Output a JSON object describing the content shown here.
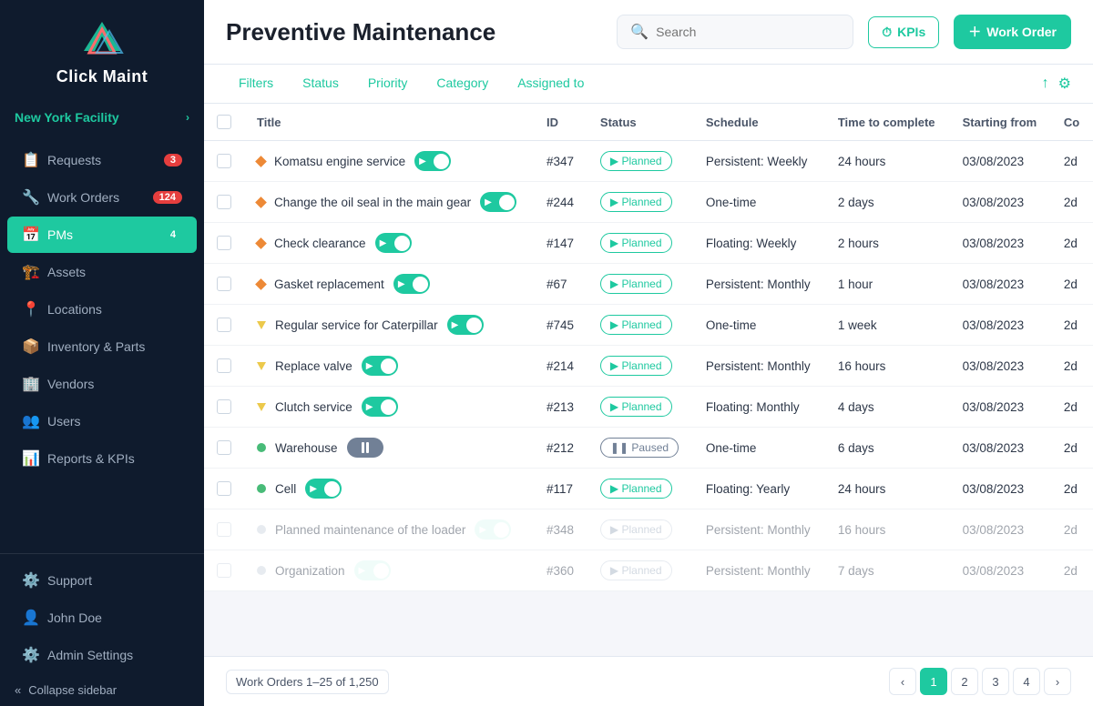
{
  "sidebar": {
    "logo_text": "Click Maint",
    "facility": "New York Facility",
    "nav_items": [
      {
        "id": "requests",
        "label": "Requests",
        "badge": "3",
        "badge_type": "red",
        "icon": "📋"
      },
      {
        "id": "work-orders",
        "label": "Work Orders",
        "badge": "124",
        "badge_type": "red",
        "icon": "🔧"
      },
      {
        "id": "pms",
        "label": "PMs",
        "badge": "4",
        "badge_type": "teal",
        "icon": "📅",
        "active": true
      },
      {
        "id": "assets",
        "label": "Assets",
        "icon": "🏗️"
      },
      {
        "id": "locations",
        "label": "Locations",
        "icon": "📍"
      },
      {
        "id": "inventory",
        "label": "Inventory & Parts",
        "icon": "📦"
      },
      {
        "id": "vendors",
        "label": "Vendors",
        "icon": "🏢"
      },
      {
        "id": "users",
        "label": "Users",
        "icon": "👥"
      },
      {
        "id": "reports",
        "label": "Reports & KPIs",
        "icon": "📊"
      }
    ],
    "bottom": {
      "support": "Support",
      "user": "John Doe",
      "admin": "Admin Settings",
      "collapse": "Collapse sidebar"
    }
  },
  "header": {
    "title": "Preventive Maintenance",
    "search_placeholder": "Search",
    "kpi_label": "KPIs",
    "work_order_label": "Work Order"
  },
  "filters": {
    "items": [
      "Filters",
      "Status",
      "Priority",
      "Category",
      "Assigned to"
    ]
  },
  "table": {
    "columns": [
      "Title",
      "ID",
      "Status",
      "Schedule",
      "Time to complete",
      "Starting from",
      "Co"
    ],
    "rows": [
      {
        "title": "Komatsu engine service",
        "priority": "orange",
        "toggle": "on",
        "id": "#347",
        "status": "Planned",
        "schedule": "Persistent: Weekly",
        "time": "24 hours",
        "starting": "03/08/2023",
        "co": "2d",
        "faded": false
      },
      {
        "title": "Change the oil seal in the main gear",
        "priority": "orange",
        "toggle": "on",
        "id": "#244",
        "status": "Planned",
        "schedule": "One-time",
        "time": "2 days",
        "starting": "03/08/2023",
        "co": "2d",
        "faded": false
      },
      {
        "title": "Check clearance",
        "priority": "orange",
        "toggle": "on",
        "id": "#147",
        "status": "Planned",
        "schedule": "Floating: Weekly",
        "time": "2 hours",
        "starting": "03/08/2023",
        "co": "2d",
        "faded": false
      },
      {
        "title": "Gasket replacement",
        "priority": "orange",
        "toggle": "on",
        "id": "#67",
        "status": "Planned",
        "schedule": "Persistent: Monthly",
        "time": "1 hour",
        "starting": "03/08/2023",
        "co": "2d",
        "faded": false
      },
      {
        "title": "Regular service for Caterpillar",
        "priority": "yellow",
        "toggle": "on",
        "id": "#745",
        "status": "Planned",
        "schedule": "One-time",
        "time": "1 week",
        "starting": "03/08/2023",
        "co": "2d",
        "faded": false
      },
      {
        "title": "Replace valve",
        "priority": "yellow",
        "toggle": "on",
        "id": "#214",
        "status": "Planned",
        "schedule": "Persistent: Monthly",
        "time": "16 hours",
        "starting": "03/08/2023",
        "co": "2d",
        "faded": false
      },
      {
        "title": "Clutch service",
        "priority": "yellow",
        "toggle": "on",
        "id": "#213",
        "status": "Planned",
        "schedule": "Floating: Monthly",
        "time": "4 days",
        "starting": "03/08/2023",
        "co": "2d",
        "faded": false
      },
      {
        "title": "Warehouse",
        "priority": "green",
        "toggle": "paused",
        "id": "#212",
        "status": "Paused",
        "schedule": "One-time",
        "time": "6 days",
        "starting": "03/08/2023",
        "co": "2d",
        "faded": false
      },
      {
        "title": "Cell",
        "priority": "green",
        "toggle": "on",
        "id": "#117",
        "status": "Planned",
        "schedule": "Floating: Yearly",
        "time": "24 hours",
        "starting": "03/08/2023",
        "co": "2d",
        "faded": false
      },
      {
        "title": "Planned maintenance of the loader",
        "priority": "gray",
        "toggle": "on",
        "id": "#348",
        "status": "Planned",
        "schedule": "Persistent: Monthly",
        "time": "16 hours",
        "starting": "03/08/2023",
        "co": "2d",
        "faded": true
      },
      {
        "title": "Organization",
        "priority": "gray",
        "toggle": "on",
        "id": "#360",
        "status": "Planned",
        "schedule": "Persistent: Monthly",
        "time": "7 days",
        "starting": "03/08/2023",
        "co": "2d",
        "faded": true
      }
    ]
  },
  "footer": {
    "count_label": "Work Orders 1–25 of 1,250",
    "pages": [
      "1",
      "2",
      "3",
      "4"
    ]
  }
}
